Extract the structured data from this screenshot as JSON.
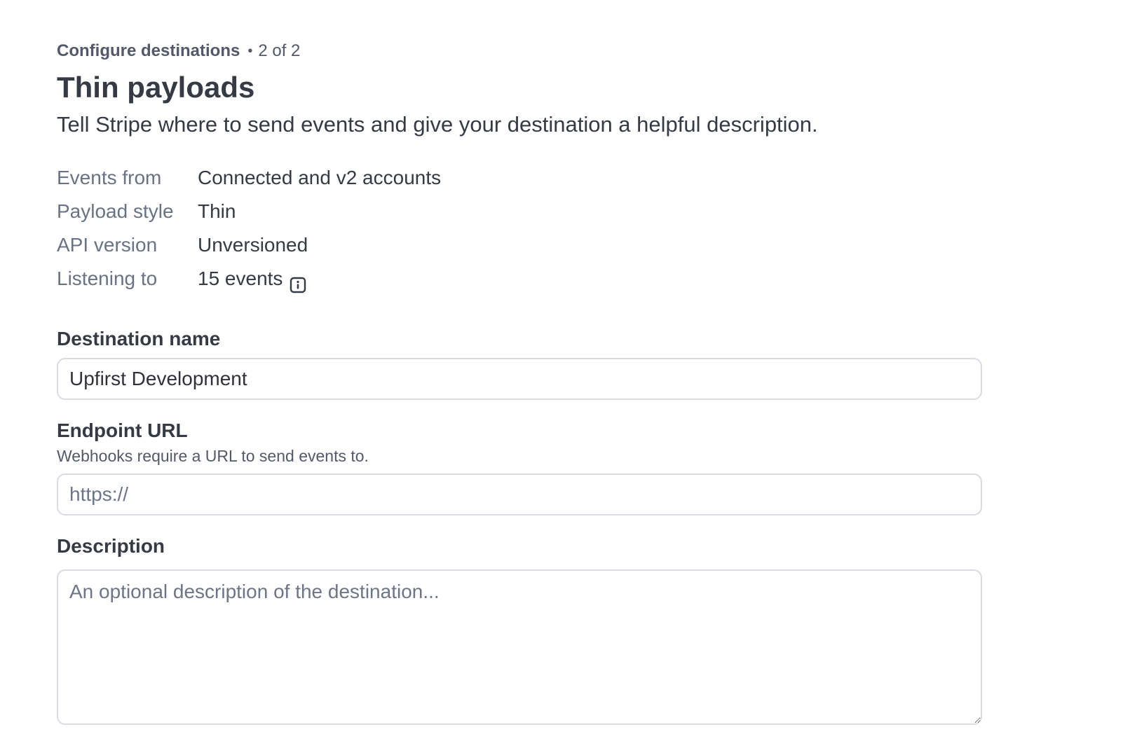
{
  "header": {
    "step_title": "Configure destinations",
    "step_separator": "•",
    "step_progress": "2 of 2",
    "title": "Thin payloads",
    "subtitle": "Tell Stripe where to send events and give your destination a helpful description."
  },
  "details": [
    {
      "label": "Events from",
      "value": "Connected and v2 accounts"
    },
    {
      "label": "Payload style",
      "value": "Thin"
    },
    {
      "label": "API version",
      "value": "Unversioned"
    },
    {
      "label": "Listening to",
      "value": "15 events",
      "icon": "info-icon"
    }
  ],
  "form": {
    "destination_name": {
      "label": "Destination name",
      "value": "Upfirst Development"
    },
    "endpoint_url": {
      "label": "Endpoint URL",
      "help": "Webhooks require a URL to send events to.",
      "placeholder": "https://",
      "value": ""
    },
    "description": {
      "label": "Description",
      "placeholder": "An optional description of the destination...",
      "value": ""
    }
  },
  "colors": {
    "text": "#353a44",
    "muted": "#687385",
    "border": "#d8dbe2"
  }
}
